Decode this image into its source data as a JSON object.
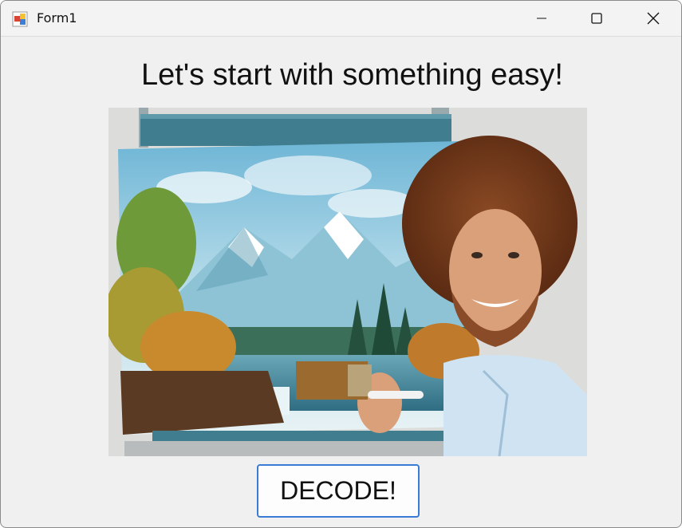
{
  "window": {
    "title": "Form1",
    "icon": "winforms-app-icon",
    "controls": [
      "minimize-icon",
      "maximize-icon",
      "close-icon"
    ]
  },
  "main": {
    "heading": "Let's start with something easy!",
    "image": "painter-with-landscape-painting",
    "decode_button": "DECODE!"
  },
  "colors": {
    "window_bg": "#f0f0f0",
    "button_border": "#3a7bd5"
  }
}
